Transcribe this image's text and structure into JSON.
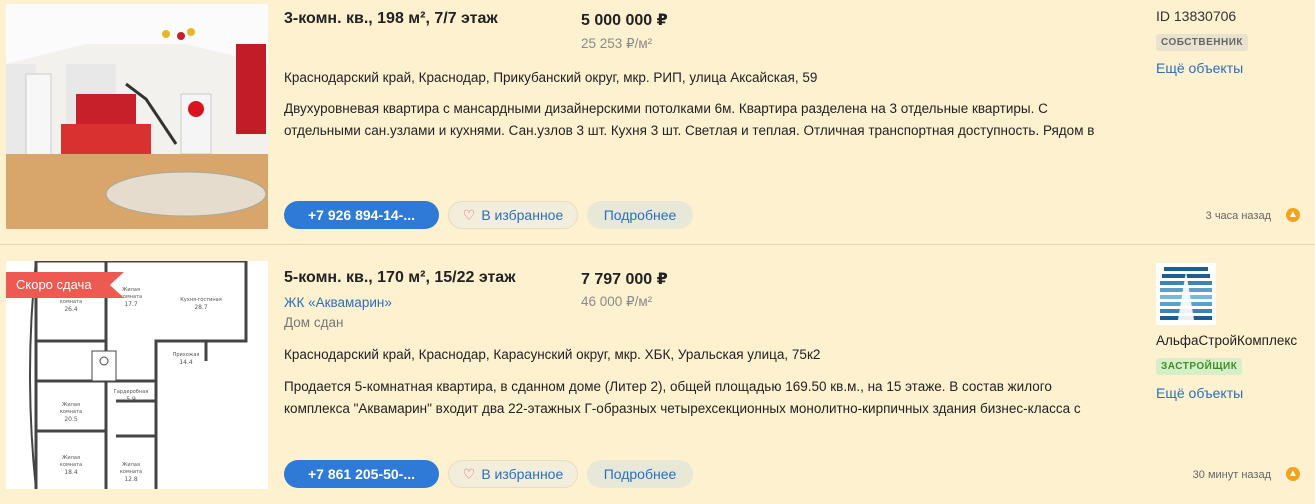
{
  "listings": [
    {
      "title": "3-комн. кв., 198 м², 7/7 этаж",
      "price": "5 000 000 ₽",
      "price_per_m2": "25 253 ₽/м²",
      "address": "Краснодарский край, Краснодар, Прикубанский округ, мкр. РИП, улица Аксайская, 59",
      "description_line1": "Двухуровневая квартира с мансардными дизайнерскими потолками 6м. Квартира разделена на 3 отдельные квартиры. С",
      "description_line2": "отдельными сан.узлами и кухнями. Сан.узлов 3 шт. Кухня 3 шт. Светлая и теплая. Отличная транспортная доступность. Рядом в",
      "phone": "+7 926 894-14-...",
      "favorite": "В избранное",
      "more": "Подробнее",
      "id": "ID 13830706",
      "badge": "СОБСТВЕННИК",
      "more_objects": "Ещё объекты",
      "time_ago": "3 часа назад"
    },
    {
      "ribbon": "Скоро сдача",
      "title": "5-комн. кв., 170 м², 15/22 этаж",
      "price": "7 797 000 ₽",
      "price_per_m2": "46 000 ₽/м²",
      "complex": "ЖК «Аквамарин»",
      "status": "Дом сдан",
      "address": "Краснодарский край, Краснодар, Карасунский округ, мкр. ХБК, Уральская улица, 75к2",
      "description_line1": "Продается 5-комнатная квартира, в сданном доме (Литер 2), общей площадью 169.50 кв.м., на 15 этаже. В состав жилого",
      "description_line2": "комплекса \"Аквамарин\" входит два 22-этажных Г-образных четырехсекционных монолитно-кирпичных здания бизнес-класса с",
      "phone": "+7 861 205-50-...",
      "favorite": "В избранное",
      "more": "Подробнее",
      "developer": "АльфаСтройКомплекс",
      "badge": "ЗАСТРОЙЩИК",
      "more_objects": "Ещё объекты",
      "time_ago": "30 минут назад",
      "plan_labels": [
        "Жилая комната 26.4",
        "Жилая комната 17.7",
        "Кухня-гостиная 28.7",
        "Прихожая 14.4",
        "Жилая комната 20.5",
        "Жилая комната 18.4",
        "Жилая комната 12.8"
      ]
    }
  ],
  "colors": {
    "background": "#fdf1cf",
    "accent_blue": "#2f7ad6",
    "ribbon_red": "#ee5a52",
    "up_orange": "#f3a21b"
  }
}
